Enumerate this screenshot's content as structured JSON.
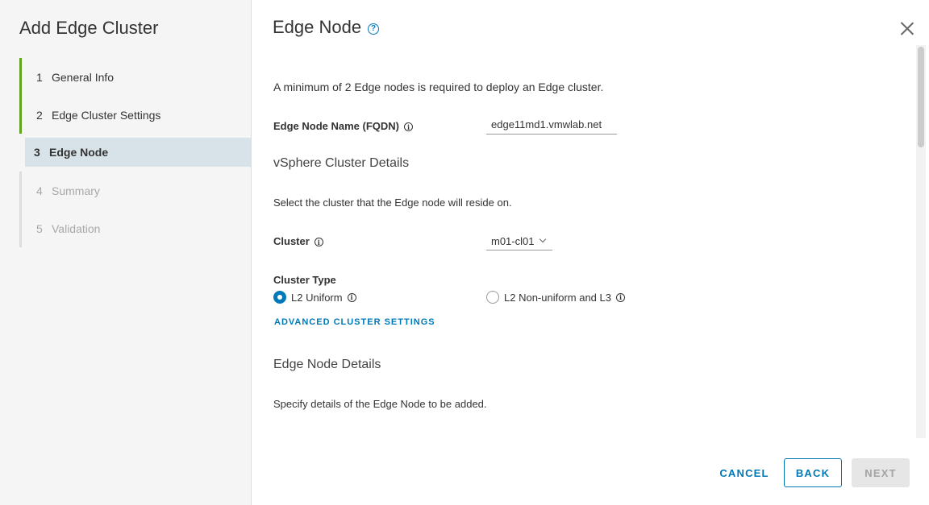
{
  "wizard": {
    "title": "Add Edge Cluster",
    "steps": [
      {
        "num": "1",
        "label": "General Info",
        "state": "completed"
      },
      {
        "num": "2",
        "label": "Edge Cluster Settings",
        "state": "completed"
      },
      {
        "num": "3",
        "label": "Edge Node",
        "state": "active"
      },
      {
        "num": "4",
        "label": "Summary",
        "state": "disabled"
      },
      {
        "num": "5",
        "label": "Validation",
        "state": "disabled"
      }
    ]
  },
  "page": {
    "title": "Edge Node",
    "help_glyph": "?",
    "intro": "A minimum of 2 Edge nodes is required to deploy an Edge cluster.",
    "node_name": {
      "label": "Edge Node Name (FQDN)",
      "value": "edge11md1.vmwlab.net"
    },
    "vsphere_section": "vSphere Cluster Details",
    "vsphere_desc": "Select the cluster that the Edge node will reside on.",
    "cluster": {
      "label": "Cluster",
      "value": "m01-cl01"
    },
    "cluster_type": {
      "label": "Cluster Type",
      "options": [
        {
          "label": "L2 Uniform",
          "selected": true
        },
        {
          "label": "L2 Non-uniform and L3",
          "selected": false
        }
      ]
    },
    "advanced_link": "ADVANCED CLUSTER SETTINGS",
    "node_details_section": "Edge Node Details",
    "node_details_desc": "Specify details of the Edge Node to be added."
  },
  "footer": {
    "cancel": "CANCEL",
    "back": "BACK",
    "next": "NEXT"
  },
  "colors": {
    "accent": "#0079b8",
    "completed": "#62a420",
    "active_step_bg": "#d8e3e9"
  },
  "icons": {
    "info": "i"
  }
}
